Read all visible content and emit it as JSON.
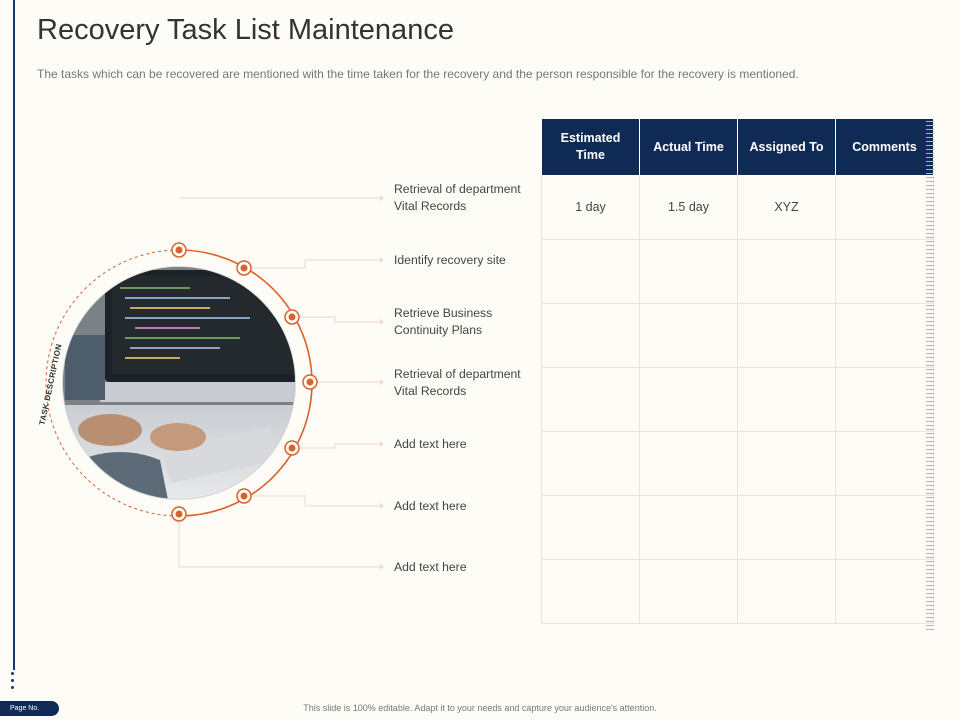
{
  "title": "Recovery Task List Maintenance",
  "subtitle": "The tasks which can be recovered are mentioned with the time taken for the recovery and the person responsible  for the recovery is mentioned.",
  "side_label": "TASK DESCRIPTION",
  "tasks": [
    {
      "label": "Retrieval of  department\nVital Records"
    },
    {
      "label": "Identify recovery site"
    },
    {
      "label": "Retrieve Business\nContinuity Plans"
    },
    {
      "label": "Retrieval of  department\nVital Records"
    },
    {
      "label": "Add text here"
    },
    {
      "label": "Add text here"
    },
    {
      "label": "Add text here"
    }
  ],
  "table": {
    "headers": [
      "Estimated\nTime",
      "Actual Time",
      "Assigned To",
      "Comments"
    ],
    "rows": [
      [
        "1 day",
        "1.5 day",
        "XYZ",
        ""
      ],
      [
        "",
        "",
        "",
        ""
      ],
      [
        "",
        "",
        "",
        ""
      ],
      [
        "",
        "",
        "",
        ""
      ],
      [
        "",
        "",
        "",
        ""
      ],
      [
        "",
        "",
        "",
        ""
      ],
      [
        "",
        "",
        "",
        ""
      ]
    ]
  },
  "colors": {
    "accent": "#d9622b",
    "header_bg": "#0f2a54",
    "background": "#fdfcf6"
  },
  "footer": {
    "page_label": "Page No.",
    "note": "This slide is 100% editable. Adapt it to your needs and capture your audience's attention."
  }
}
